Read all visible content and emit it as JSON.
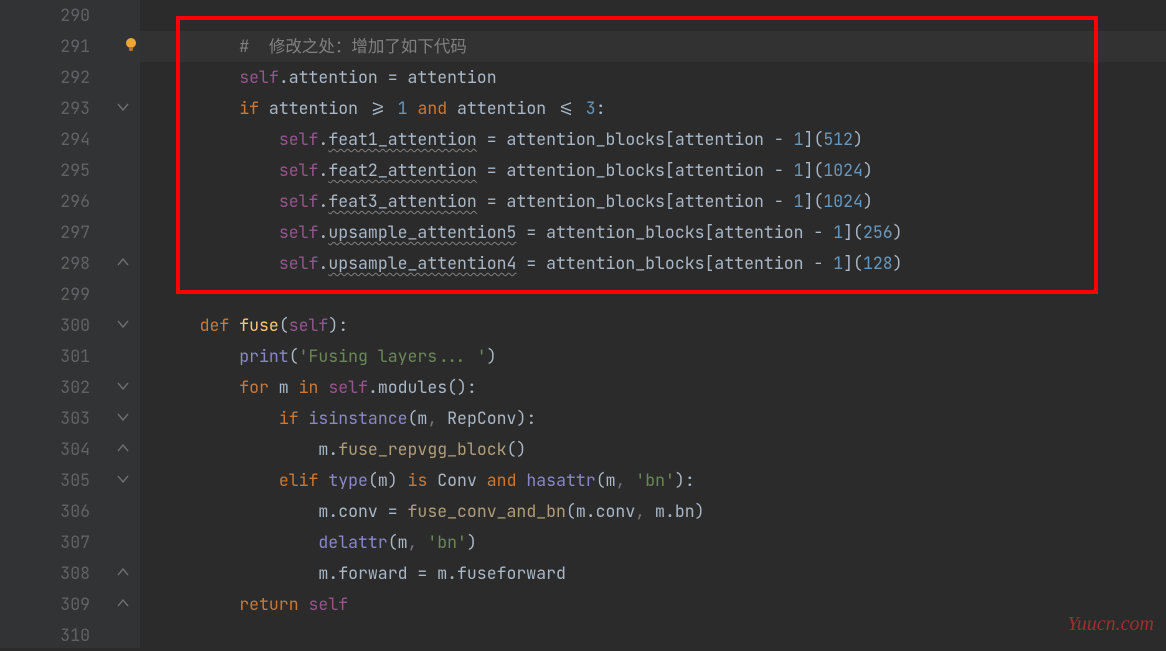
{
  "gutter": {
    "start": 290,
    "numbers": [
      "290",
      "291",
      "292",
      "293",
      "294",
      "295",
      "296",
      "297",
      "298",
      "299",
      "300",
      "301",
      "302",
      "303",
      "304",
      "305",
      "306",
      "307",
      "308",
      "309",
      "310"
    ]
  },
  "code": {
    "l290": "",
    "l291_comment": "#  修改之处：增加了如下代码",
    "l292_self": "self",
    "l292_attr": ".attention = attention",
    "l293_if": "if",
    "l293_a": " attention ",
    "l293_ge": ">=",
    "l293_sp1": " ",
    "l293_n1": "1",
    "l293_sp2": " ",
    "l293_and": "and",
    "l293_b": " attention ",
    "l293_le": "<=",
    "l293_sp3": " ",
    "l293_n3": "3",
    "l293_colon": ":",
    "l294_self": "self",
    "l294_dot": ".",
    "l294_attr": "feat1_attention",
    "l294_eq": " = attention_blocks[attention - ",
    "l294_n1": "1",
    "l294_br": "](",
    "l294_n2": "512",
    "l294_end": ")",
    "l295_self": "self",
    "l295_dot": ".",
    "l295_attr": "feat2_attention",
    "l295_eq": " = attention_blocks[attention - ",
    "l295_n1": "1",
    "l295_br": "](",
    "l295_n2": "1024",
    "l295_end": ")",
    "l296_self": "self",
    "l296_dot": ".",
    "l296_attr": "feat3_attention",
    "l296_eq": " = attention_blocks[attention - ",
    "l296_n1": "1",
    "l296_br": "](",
    "l296_n2": "1024",
    "l296_end": ")",
    "l297_self": "self",
    "l297_dot": ".",
    "l297_attr": "upsample_attention5",
    "l297_eq": " = attention_blocks[attention - ",
    "l297_n1": "1",
    "l297_br": "](",
    "l297_n2": "256",
    "l297_end": ")",
    "l298_self": "self",
    "l298_dot": ".",
    "l298_attr": "upsample_attention4",
    "l298_eq": " = attention_blocks[attention - ",
    "l298_n1": "1",
    "l298_br": "](",
    "l298_n2": "128",
    "l298_end": ")",
    "l300_def": "def",
    "l300_sp": " ",
    "l300_name": "fuse",
    "l300_op": "(",
    "l300_self": "self",
    "l300_cl": "):",
    "l301_print": "print",
    "l301_op": "(",
    "l301_str": "'Fusing layers... '",
    "l301_cl": ")",
    "l302_for": "for",
    "l302_a": " m ",
    "l302_in": "in",
    "l302_sp": " ",
    "l302_self": "self",
    "l302_b": ".modules():",
    "l303_if": "if",
    "l303_sp": " ",
    "l303_isi": "isinstance",
    "l303_op": "(m",
    "l303_comma": ", ",
    "l303_rep": "RepConv):",
    "l304_a": "m.",
    "l304_call": "fuse_repvgg_block",
    "l304_b": "()",
    "l305_elif": "elif",
    "l305_sp": " ",
    "l305_type": "type",
    "l305_a": "(m) ",
    "l305_is": "is",
    "l305_b": " Conv ",
    "l305_and": "and",
    "l305_sp2": " ",
    "l305_has": "hasattr",
    "l305_c": "(m",
    "l305_comma": ", ",
    "l305_str": "'bn'",
    "l305_d": "):",
    "l306_a": "m.conv = ",
    "l306_call": "fuse_conv_and_bn",
    "l306_b": "(m.conv",
    "l306_comma": ", ",
    "l306_c": "m.bn)",
    "l307_del": "delattr",
    "l307_a": "(m",
    "l307_comma": ", ",
    "l307_str": "'bn'",
    "l307_b": ")",
    "l308_a": "m.forward = m.fuseforward",
    "l309_ret": "return",
    "l309_sp": " ",
    "l309_self": "self"
  },
  "watermark": "Yuucn.com"
}
